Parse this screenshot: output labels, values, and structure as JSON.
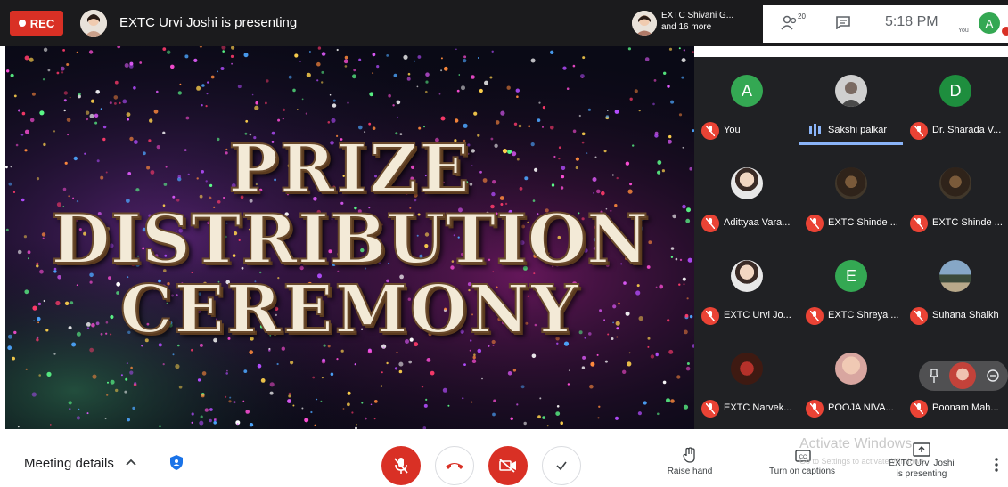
{
  "topbar": {
    "rec_label": "REC",
    "presenting_text": "EXTC Urvi Joshi is presenting",
    "others_line1": "EXTC Shivani G...",
    "others_line2": "and 16 more",
    "people_count": "20",
    "clock": "5:18 PM",
    "you_label": "You",
    "you_initial": "A"
  },
  "stage": {
    "title_line1": "PRIZE",
    "title_line2": "DISTRIBUTION",
    "title_line3": "CEREMONY"
  },
  "participants": [
    {
      "name": "You",
      "initial": "A",
      "avatar_color": "#34a853",
      "muted": true
    },
    {
      "name": "Sakshi palkar",
      "initial": "",
      "avatar_color": "#5f6368",
      "muted": false,
      "speaking": true
    },
    {
      "name": "Dr. Sharada V...",
      "initial": "D",
      "avatar_color": "#1e8e3e",
      "muted": true
    },
    {
      "name": "Adittyaa Vara...",
      "initial": "",
      "avatar_color": "#ffffff",
      "muted": true
    },
    {
      "name": "EXTC Shinde ...",
      "initial": "",
      "avatar_color": "#3b2a1e",
      "muted": true
    },
    {
      "name": "EXTC Shinde ...",
      "initial": "",
      "avatar_color": "#3b2a1e",
      "muted": true
    },
    {
      "name": "EXTC Urvi Jo...",
      "initial": "",
      "avatar_color": "#ffffff",
      "muted": true
    },
    {
      "name": "EXTC Shreya ...",
      "initial": "E",
      "avatar_color": "#34a853",
      "muted": true
    },
    {
      "name": "Suhana Shaikh",
      "initial": "",
      "avatar_color": "#86a7c6",
      "muted": true
    },
    {
      "name": "EXTC Narvek...",
      "initial": "",
      "avatar_color": "#b5312a",
      "muted": true
    },
    {
      "name": "POOJA NIVA...",
      "initial": "",
      "avatar_color": "#f0c9b4",
      "muted": true
    },
    {
      "name": "Poonam Mah...",
      "initial": "",
      "avatar_color": "#d8a6a0",
      "muted": true
    }
  ],
  "bottombar": {
    "meeting_details": "Meeting details",
    "raise_hand": "Raise hand",
    "captions": "Turn on captions",
    "presenting_line1": "EXTC Urvi Joshi",
    "presenting_line2": "is presenting",
    "watermark_title": "Activate Windows",
    "watermark_sub": "Go to Settings to activate Windows."
  },
  "colors": {
    "accent_red": "#d93025",
    "speaking_blue": "#8ab4f8",
    "grid_bg": "#202124"
  }
}
